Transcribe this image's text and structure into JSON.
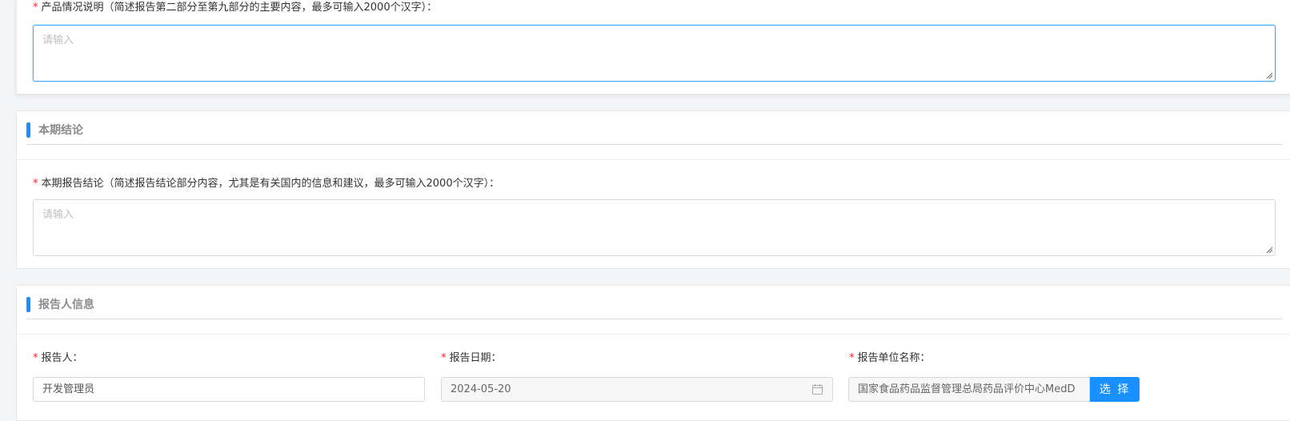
{
  "product_section": {
    "field_label": "产品情况说明（简述报告第二部分至第九部分的主要内容，最多可输入2000个汉字）：",
    "placeholder": "请输入"
  },
  "conclusion_section": {
    "title": "本期结论",
    "field_label": "本期报告结论（简述报告结论部分内容，尤其是有关国内的信息和建议，最多可输入2000个汉字）：",
    "placeholder": "请输入"
  },
  "reporter_section": {
    "title": "报告人信息",
    "reporter": {
      "label": "报告人：",
      "value": "开发管理员"
    },
    "report_date": {
      "label": "报告日期：",
      "value": "2024-05-20"
    },
    "report_unit": {
      "label": "报告单位名称：",
      "value": "国家食品药品监督管理总局药品评价中心MedD",
      "button_label": "选 择"
    }
  },
  "required_mark": "*",
  "colors": {
    "accent": "#1890ff",
    "required": "#f5222d",
    "focus_border": "#40a9ff"
  },
  "icons": {
    "calendar": "calendar-icon",
    "resize": "resize-handle-icon"
  }
}
